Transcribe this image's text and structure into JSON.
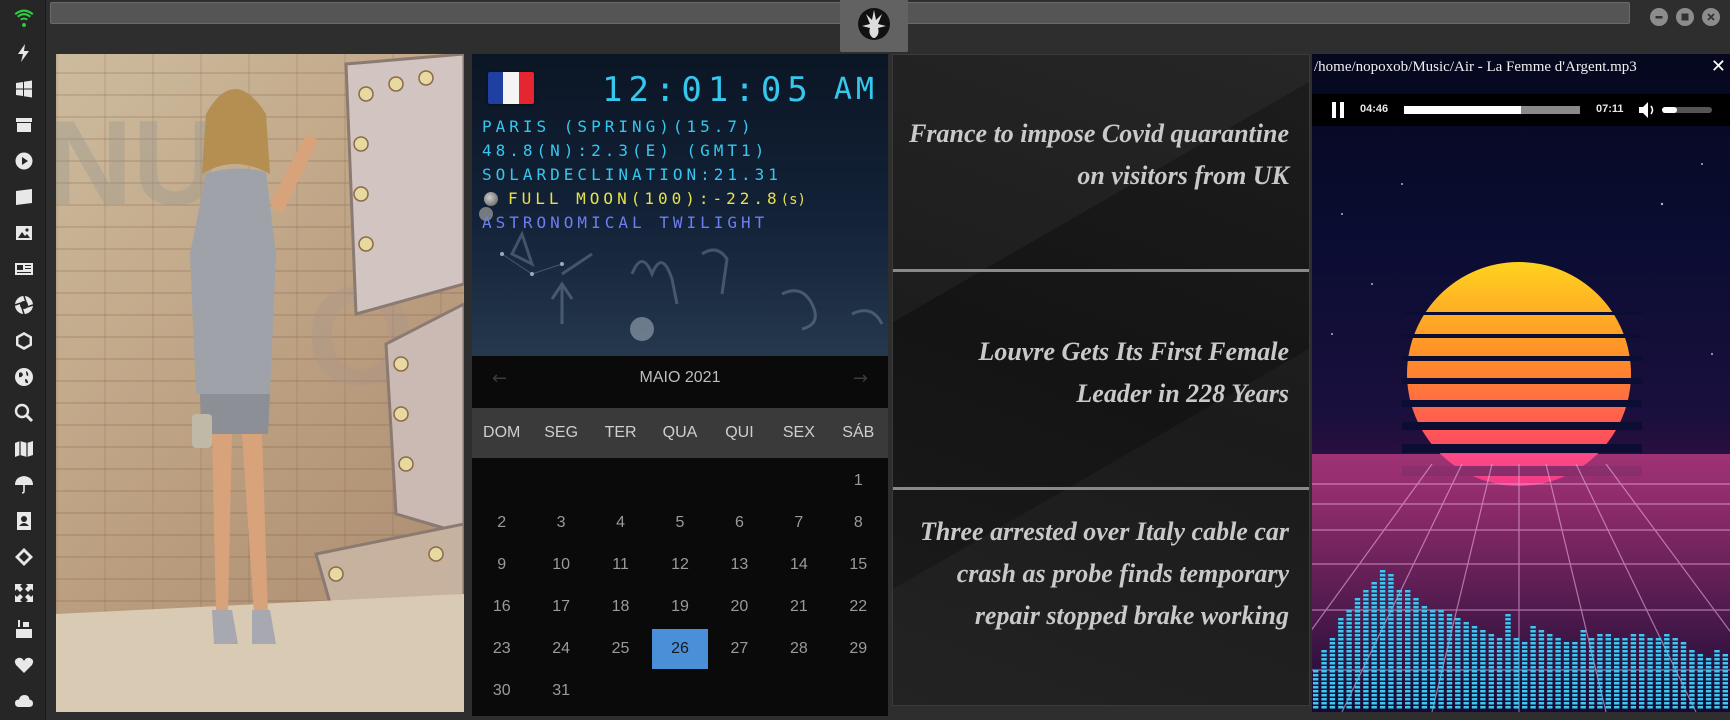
{
  "sidebar": {
    "icons": [
      "wifi-icon",
      "lightning-icon",
      "windows-icon",
      "archive-icon",
      "play-icon",
      "photo-book-icon",
      "image-icon",
      "news-icon",
      "aperture-icon",
      "hexagon-icon",
      "globe-icon",
      "search-icon",
      "map-icon",
      "umbrella-icon",
      "contacts-icon",
      "tag-icon",
      "expand-icon",
      "youtube-icon",
      "heart-icon",
      "cloud-icon"
    ],
    "wifi_color": "#2ecc40"
  },
  "clock": {
    "time": "12:01:05",
    "ampm": "AM",
    "line1": "PARIS (SPRING)(15.7)",
    "line2": "48.8(N):2.3(E) (GMT1)",
    "line3": "SOLARDECLINATION:21.31",
    "moon": "FULL MOON(100):-22.8",
    "moon_suffix": "(s)",
    "line5": "ASTRONOMICAL TWILIGHT",
    "flag_colors": [
      "#1f3fa3",
      "#f4f4f4",
      "#e3262f"
    ]
  },
  "calendar": {
    "title": "MAIO 2021",
    "prev": "←",
    "next": "→",
    "weekdays": [
      "DOM",
      "SEG",
      "TER",
      "QUA",
      "QUI",
      "SEX",
      "SÁB"
    ],
    "first_weekday_index": 6,
    "days_in_month": 31,
    "today": 26,
    "today_color": "#4a90d9"
  },
  "news": {
    "headlines": [
      "France to impose Covid quarantine on visitors from UK",
      "Louvre Gets Its First Female Leader in 228 Years",
      "Three arrested over Italy cable car crash as probe finds temporary repair stopped brake working"
    ]
  },
  "player": {
    "file_path": "/home/nopoxob/Music/Air - La Femme d'Argent.mp3",
    "close": "✕",
    "elapsed": "04:46",
    "duration": "07:11",
    "progress_fraction": 0.664,
    "volume_fraction": 0.3,
    "spectrum_color": "#3ec8f0"
  }
}
